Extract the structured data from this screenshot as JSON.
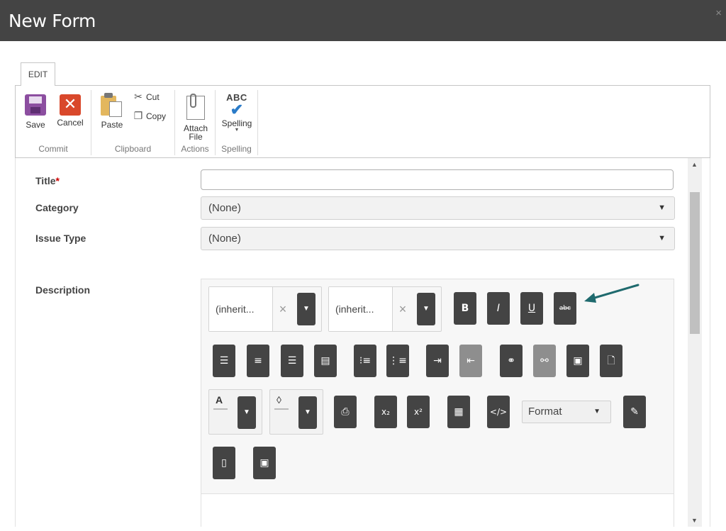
{
  "window": {
    "title": "New Form",
    "close_glyph": "×"
  },
  "ribbon": {
    "tab_label": "EDIT",
    "groups": {
      "commit": {
        "label": "Commit",
        "save": "Save",
        "cancel": "Cancel"
      },
      "clipboard": {
        "label": "Clipboard",
        "paste": "Paste",
        "cut": "Cut",
        "copy": "Copy"
      },
      "actions": {
        "label": "Actions",
        "attach_line1": "Attach",
        "attach_line2": "File"
      },
      "spelling": {
        "label": "Spelling",
        "spelling": "Spelling",
        "abc": "ABC"
      }
    }
  },
  "form": {
    "title_label": "Title",
    "required_mark": "*",
    "title_value": "",
    "category_label": "Category",
    "category_value": "(None)",
    "issue_type_label": "Issue Type",
    "issue_type_value": "(None)",
    "description_label": "Description"
  },
  "editor": {
    "font_family_value": "(inherit...",
    "font_size_value": "(inherit...",
    "bold": "B",
    "italic": "I",
    "underline": "U",
    "strikethrough": "abc",
    "format_value": "Format",
    "subscript": "x₂",
    "superscript": "x²",
    "font_color_symbol": "A",
    "highlight_symbol": "💧"
  },
  "colors": {
    "titlebar": "#444444",
    "toolbar_button": "#444444",
    "arrow": "#1f6a6e",
    "save_icon": "#8c4ea0",
    "cancel_icon": "#d9482b"
  }
}
